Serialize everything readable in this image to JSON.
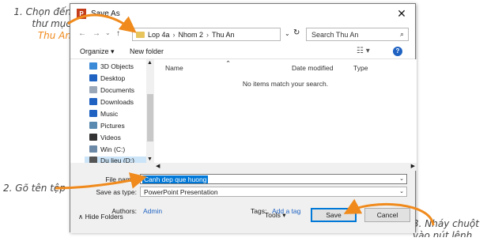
{
  "annotations": {
    "step1_lines": [
      "1. Chọn đến",
      "thư mục"
    ],
    "step1_folder": "Thu An",
    "step2": "2. Gõ tên tệp",
    "step3_lines": [
      "3. Nháy chuột",
      "vào nút lệnh"
    ],
    "accent_color": "#f08a1c"
  },
  "dialog": {
    "title": "Save As",
    "app_icon_letter": "P",
    "close_glyph": "✕",
    "nav": {
      "back": "←",
      "forward": "→",
      "down": "⌄",
      "up": "↑"
    },
    "breadcrumb": [
      "Lop 4a",
      "Nhom 2",
      "Thu An"
    ],
    "breadcrumb_sep": "›",
    "search_placeholder": "Search Thu An",
    "toolbar": {
      "organize": "Organize ▾",
      "new_folder": "New folder",
      "view": "☷ ▾",
      "help": "?"
    },
    "sidebar": [
      {
        "label": "3D Objects",
        "icon": "cube-icon",
        "color": "#3a8ad8"
      },
      {
        "label": "Desktop",
        "icon": "desktop-icon",
        "color": "#1f62c2"
      },
      {
        "label": "Documents",
        "icon": "documents-icon",
        "color": "#9aa7b8"
      },
      {
        "label": "Downloads",
        "icon": "download-icon",
        "color": "#1f62c2"
      },
      {
        "label": "Music",
        "icon": "music-icon",
        "color": "#1f62c2"
      },
      {
        "label": "Pictures",
        "icon": "pictures-icon",
        "color": "#5a8ab0"
      },
      {
        "label": "Videos",
        "icon": "videos-icon",
        "color": "#333333"
      },
      {
        "label": "Win (C:)",
        "icon": "drive-icon",
        "color": "#6c8aa8"
      },
      {
        "label": "Du lieu (D:)",
        "icon": "drive-icon",
        "color": "#555555",
        "selected": true
      }
    ],
    "columns": {
      "name": "Name",
      "date": "Date modified",
      "type": "Type"
    },
    "empty_message": "No items match your search.",
    "file_name_label": "File name:",
    "file_name_value": "Canh dep que huong",
    "save_type_label": "Save as type:",
    "save_type_value": "PowerPoint Presentation",
    "authors_label": "Authors:",
    "authors_value": "Admin",
    "tags_label": "Tags:",
    "tags_value": "Add a tag",
    "hide_folders": "∧  Hide Folders",
    "tools": "Tools  ▾",
    "save_button": "Save",
    "cancel_button": "Cancel"
  }
}
